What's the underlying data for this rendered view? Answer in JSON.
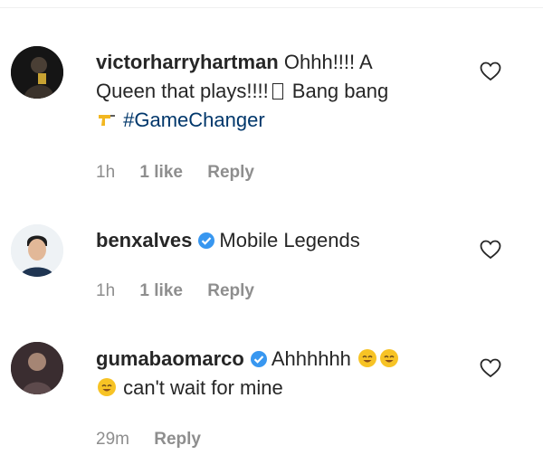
{
  "comments": [
    {
      "username": "victorharryhartman",
      "text_1": "Ohhh!!!! A",
      "text_2": "Queen that plays!!!!",
      "text_3": "Bang bang",
      "hashtag": "#GameChanger",
      "time": "1h",
      "likes": "1 like",
      "reply": "Reply",
      "avatar_icon": "person-avatar-icon",
      "emoji_icon": "pistol-emoji-icon"
    },
    {
      "username": "benxalves",
      "verified": true,
      "text_1": "Mobile Legends",
      "time": "1h",
      "likes": "1 like",
      "reply": "Reply",
      "avatar_icon": "person-avatar-icon"
    },
    {
      "username": "gumabaomarco",
      "verified": true,
      "text_1": "Ahhhhhh",
      "text_2": "can't wait for mine",
      "time": "29m",
      "reply": "Reply",
      "avatar_icon": "person-avatar-icon",
      "emoji_icon": "smiling-face-emoji-icon"
    }
  ],
  "colors": {
    "text": "#262626",
    "meta": "#8e8e8e",
    "hashtag": "#00376b",
    "verified": "#3897f0",
    "emoji": "#f7c325"
  }
}
